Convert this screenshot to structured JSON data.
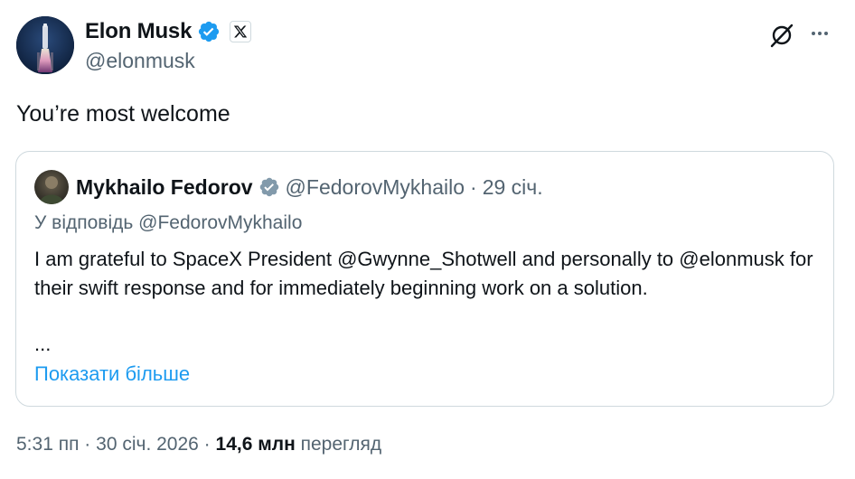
{
  "author": {
    "name": "Elon Musk",
    "handle": "@elonmusk",
    "avatar_icon": "rocket-launch-avatar",
    "verified_badge_color": "#1d9bf0",
    "affiliation_icon": "x-logo-icon"
  },
  "tweet": {
    "text": "You’re most welcome"
  },
  "quote": {
    "name": "Mykhailo Fedorov",
    "handle": "@FedorovMykhailo",
    "separator": "·",
    "date": "29 січ.",
    "verified_badge_color": "#829aab",
    "reply_to": "У відповідь @FedorovMykhailo",
    "body": "I am grateful to SpaceX President @Gwynne_Shotwell and personally to @elonmusk for their swift response and for immediately beginning work on a solution.",
    "ellipsis": "...",
    "show_more": "Показати більше"
  },
  "footer": {
    "time": "5:31 пп",
    "date": "30 січ. 2026",
    "sep1": "·",
    "sep2": "·",
    "views_count": "14,6 млн",
    "views_label": "перегляд"
  },
  "colors": {
    "text_primary": "#0f1419",
    "text_secondary": "#536471",
    "link": "#1d9bf0",
    "border": "#cfd9de"
  }
}
